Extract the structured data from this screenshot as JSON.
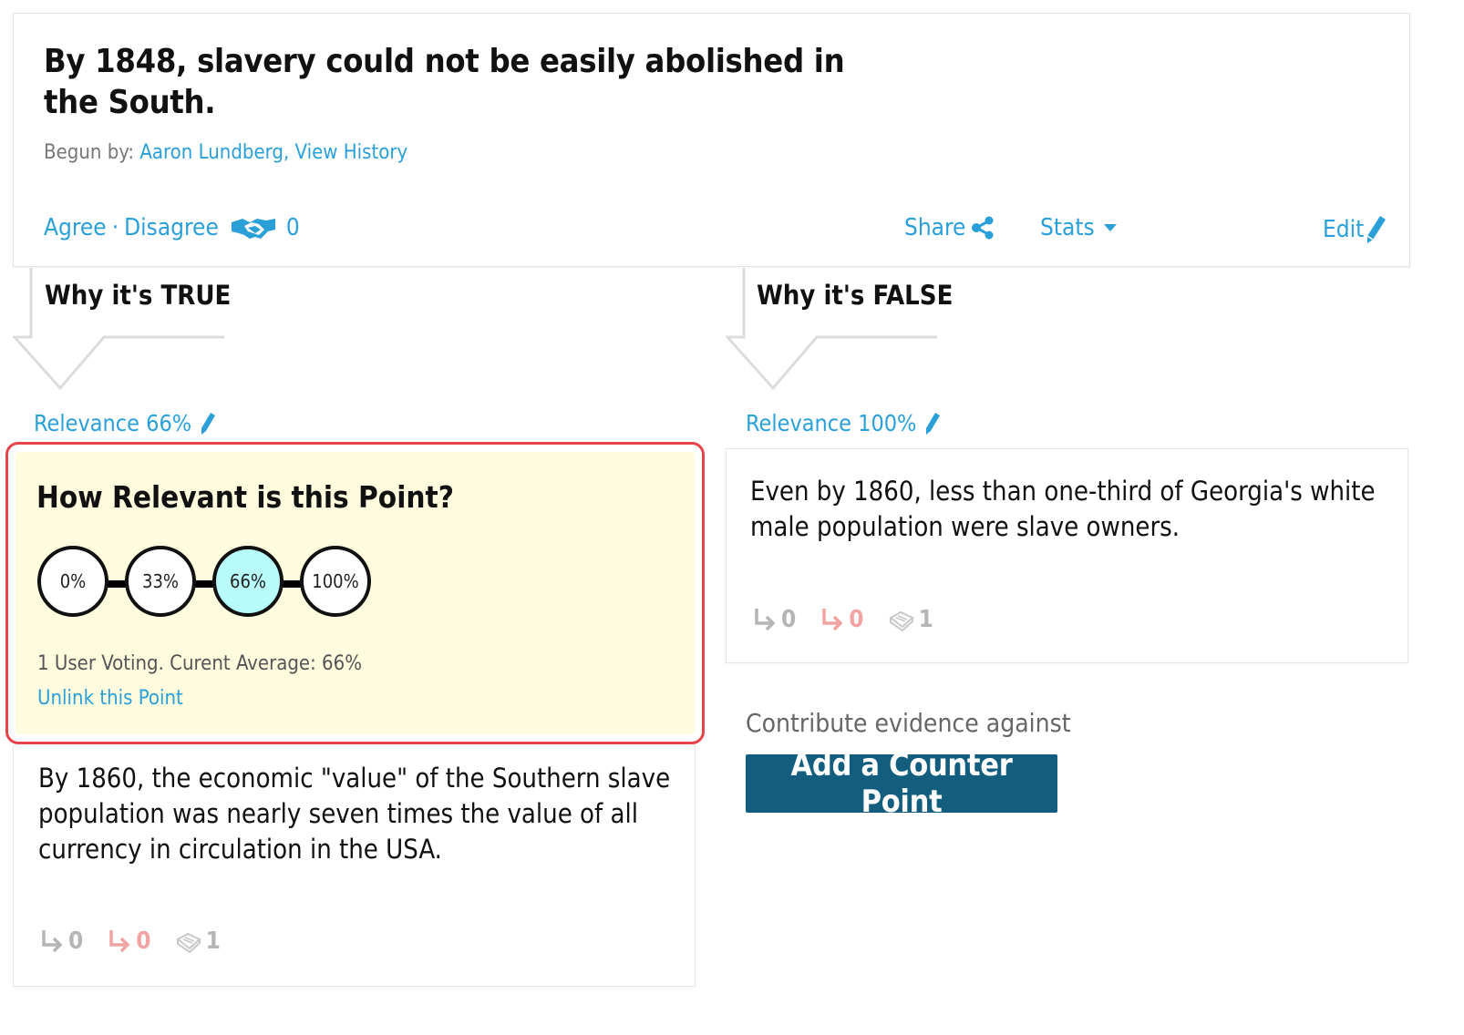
{
  "claim": {
    "title": "By 1848, slavery could not be easily abolished in the South.",
    "begun_by_label": "Begun by:",
    "author": "Aaron Lundberg",
    "view_history": "View History",
    "agree": "Agree",
    "separator": "·",
    "disagree": "Disagree",
    "vote_count": "0",
    "share": "Share",
    "stats": "Stats",
    "edit": "Edit"
  },
  "columns": {
    "true_header": "Why it's TRUE",
    "false_header": "Why it's FALSE"
  },
  "true_point": {
    "relevance": "Relevance 66%",
    "vote_box": {
      "question": "How Relevant is this Point?",
      "options": [
        "0%",
        "33%",
        "66%",
        "100%"
      ],
      "selected": "66%",
      "info": "1 User Voting. Curent Average: 66%",
      "unlink": "Unlink this Point"
    },
    "text": "By 1860, the economic \"value\" of the Southern slave population was nearly seven times the value of all currency in circulation in the USA.",
    "supporting_count": "0",
    "counter_count": "0",
    "sources_count": "1"
  },
  "false_point": {
    "relevance": "Relevance 100%",
    "text": "Even by 1860, less than one-third of Georgia's white male population were slave owners.",
    "supporting_count": "0",
    "counter_count": "0",
    "sources_count": "1"
  },
  "contribute": {
    "label": "Contribute evidence against",
    "button": "Add a Counter Point"
  },
  "colors": {
    "link": "#2a9fd8",
    "button_bg": "#135e7e",
    "highlight_border": "#e4444a",
    "vote_bg": "#fefbde",
    "selected_option": "#b8fbfb"
  },
  "icons": [
    "handshake-icon",
    "share-icon",
    "caret-down-icon",
    "pencil-icon",
    "supporting-arrow-icon",
    "counter-arrow-icon",
    "book-icon",
    "down-arrow-icon"
  ]
}
